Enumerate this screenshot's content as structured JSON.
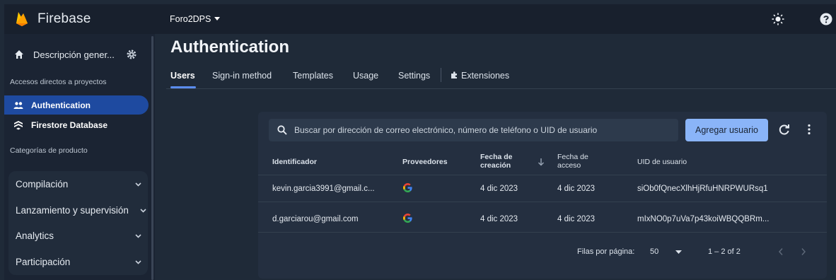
{
  "sidebar": {
    "brand": "Firebase",
    "overview": "Descripción gener...",
    "shortcuts_label": "Accesos directos a proyectos",
    "shortcuts": [
      {
        "label": "Authentication",
        "icon": "people-icon",
        "active": true
      },
      {
        "label": "Firestore Database",
        "icon": "firestore-icon",
        "active": false
      }
    ],
    "categories_label": "Categorías de producto",
    "groups": [
      {
        "label": "Compilación"
      },
      {
        "label": "Lanzamiento y supervisión"
      },
      {
        "label": "Analytics"
      },
      {
        "label": "Participación"
      }
    ]
  },
  "topbar": {
    "project": "Foro2DPS"
  },
  "page": {
    "title": "Authentication",
    "tabs": [
      {
        "label": "Users",
        "active": true
      },
      {
        "label": "Sign-in method"
      },
      {
        "label": "Templates"
      },
      {
        "label": "Usage"
      },
      {
        "label": "Settings"
      },
      {
        "label": "Extensiones"
      }
    ]
  },
  "users": {
    "search_placeholder": "Buscar por dirección de correo electrónico, número de teléfono o UID de usuario",
    "add_button": "Agregar usuario",
    "columns": {
      "identifier": "Identificador",
      "providers": "Proveedores",
      "created_1": "Fecha de",
      "created_2": "creación",
      "access_1": "Fecha de",
      "access_2": "acceso",
      "uid": "UID de usuario"
    },
    "rows": [
      {
        "identifier": "kevin.garcia3991@gmail.c...",
        "provider": "google-icon",
        "created": "4 dic 2023",
        "access": "4 dic 2023",
        "uid": "siOb0fQnecXlhHjRfuHNRPWURsq1"
      },
      {
        "identifier": "d.garciarou@gmail.com",
        "provider": "google-icon",
        "created": "4 dic 2023",
        "access": "4 dic 2023",
        "uid": "mIxNO0p7uVa7p43koiWBQQBRm..."
      }
    ],
    "footer": {
      "rows_label": "Filas por página:",
      "rows_value": "50",
      "range": "1 – 2 of 2"
    }
  },
  "colors": {
    "accent": "#8ab4f8",
    "active_nav": "#1e4aa0",
    "background": "#1f2a38"
  }
}
